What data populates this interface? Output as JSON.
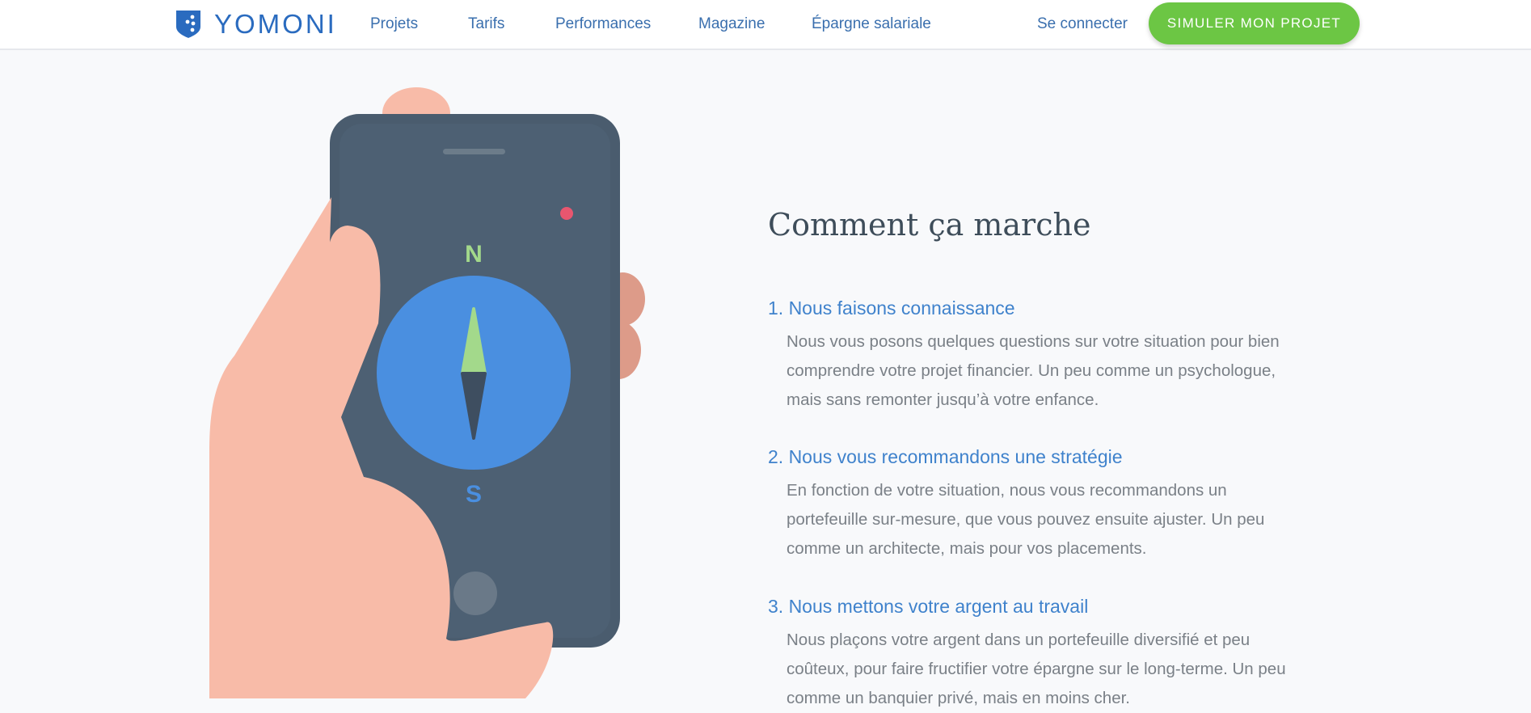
{
  "header": {
    "brand": "YOMONI",
    "nav": [
      "Projets",
      "Tarifs",
      "Performances",
      "Magazine",
      "Épargne salariale"
    ],
    "login": "Se connecter",
    "cta": "SIMULER MON PROJET"
  },
  "illustration": {
    "compass_north": "N",
    "compass_south": "S"
  },
  "main": {
    "heading": "Comment ça marche",
    "steps": [
      {
        "title": "1. Nous faisons connaissance",
        "lines": [
          "Nous vous posons quelques questions sur votre situation pour bien",
          "comprendre votre projet financier. Un peu comme un psychologue,",
          "mais sans remonter jusqu’à votre enfance."
        ]
      },
      {
        "title": "2. Nous vous recommandons une stratégie",
        "lines": [
          "En fonction de votre situation, nous vous recommandons un",
          "portefeuille sur-mesure, que vous pouvez ensuite ajuster. Un peu",
          "comme un architecte, mais pour vos placements."
        ]
      },
      {
        "title": "3. Nous mettons votre argent au travail",
        "lines": [
          "Nous plaçons votre argent dans un portefeuille diversifié et peu",
          "coûteux, pour faire fructifier votre épargne sur le long-terme. Un peu",
          "comme un banquier privé, mais en moins cher."
        ]
      }
    ]
  },
  "colors": {
    "brand_blue": "#2a6bbf",
    "nav_blue": "#3a6fae",
    "cta_green": "#6cc644",
    "step_title_blue": "#3f82cc",
    "body_gray": "#7a8087",
    "phone_body": "#4a5c6e",
    "skin": "#f8bba8",
    "compass_blue": "#4a8fe0",
    "needle_green": "#a3d98b"
  }
}
